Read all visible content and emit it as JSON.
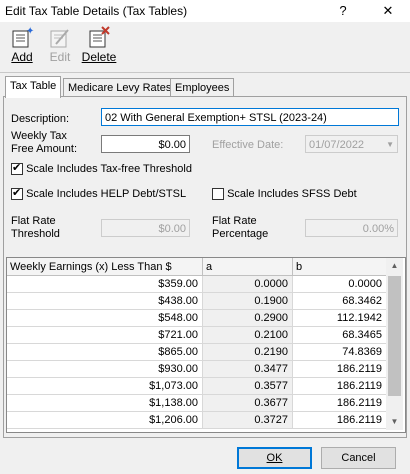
{
  "window": {
    "title": "Edit Tax Table Details (Tax Tables)",
    "help_btn": "?",
    "close_btn": "✕"
  },
  "toolbar": {
    "add": "Add",
    "edit": "Edit",
    "delete": "Delete"
  },
  "tabs": [
    {
      "label": "Tax Table"
    },
    {
      "label": "Medicare Levy Rates"
    },
    {
      "label": "Employees"
    }
  ],
  "form": {
    "description_label": "Description:",
    "description_value": "02 With General Exemption+ STSL (2023-24)",
    "weekly_tax_free_label_1": "Weekly Tax",
    "weekly_tax_free_label_2": "Free Amount:",
    "weekly_tax_free_value": "$0.00",
    "effective_date_label": "Effective Date:",
    "effective_date_value": "01/07/2022",
    "chk_tax_free_threshold": "Scale Includes Tax-free Threshold",
    "chk_help_debt": "Scale Includes HELP Debt/STSL",
    "chk_sfss_debt": "Scale Includes SFSS Debt",
    "flat_rate_threshold_label_1": "Flat Rate",
    "flat_rate_threshold_label_2": "Threshold",
    "flat_rate_threshold_value": "$0.00",
    "flat_rate_percentage_label_1": "Flat Rate",
    "flat_rate_percentage_label_2": "Percentage",
    "flat_rate_percentage_value": "0.00%"
  },
  "grid": {
    "headers": [
      "Weekly Earnings (x) Less Than $",
      "a",
      "b"
    ],
    "rows": [
      [
        "$359.00",
        "0.0000",
        "0.0000"
      ],
      [
        "$438.00",
        "0.1900",
        "68.3462"
      ],
      [
        "$548.00",
        "0.2900",
        "112.1942"
      ],
      [
        "$721.00",
        "0.2100",
        "68.3465"
      ],
      [
        "$865.00",
        "0.2190",
        "74.8369"
      ],
      [
        "$930.00",
        "0.3477",
        "186.2119"
      ],
      [
        "$1,073.00",
        "0.3577",
        "186.2119"
      ],
      [
        "$1,138.00",
        "0.3677",
        "186.2119"
      ],
      [
        "$1,206.00",
        "0.3727",
        "186.2119"
      ]
    ]
  },
  "buttons": {
    "ok": "OK",
    "cancel": "Cancel"
  }
}
